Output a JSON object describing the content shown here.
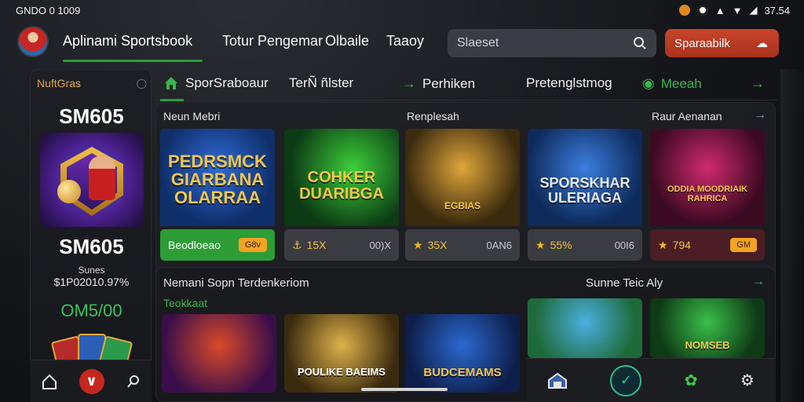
{
  "status": {
    "left_text": "GNDO 0 1009",
    "time": "37.54"
  },
  "nav": {
    "brand": "Aplinami Sportsbook",
    "items": [
      "Totur Pengemar",
      "Olbaile",
      "Taaoy"
    ]
  },
  "search": {
    "placeholder": "Slaeset"
  },
  "promo_button": "Sparaabilk",
  "sidebar": {
    "header": "NuftGras",
    "title": "SM605",
    "value_big": "SM605",
    "label_small": "Sunes",
    "amount": "$1P02010.97%",
    "green_value": "OM5/00"
  },
  "tabs": [
    {
      "label": "SporSraboaur",
      "icon": "home-icon"
    },
    {
      "label": "TerÑ ñlster",
      "icon": ""
    },
    {
      "label": "Perhiken",
      "icon": "arrow-right-icon"
    },
    {
      "label": "Pretenglstmog",
      "icon": ""
    },
    {
      "label": "Meeah",
      "icon": "target-icon"
    }
  ],
  "sections": {
    "row1_left": "Neun Mebri",
    "row1_mid": "Renplesah",
    "row1_right": "Raur Aenanan",
    "row2_left": "Nemani Sopn Terdenkeriom",
    "row2_sub": "Teokkaat",
    "row2_right": "Sunne Teic Aly"
  },
  "cards": [
    {
      "title": "PEDRSMCK GIARBANA OLARRAA",
      "rate": "",
      "pct": "",
      "badge": "Beodloeao",
      "pill": "G8v",
      "bg": "#0f3f8a",
      "text_color": "#f3c64a"
    },
    {
      "title": "COHKER DUARIBGA",
      "rate": "15X",
      "pct": "00)X",
      "badge": "",
      "pill": "",
      "bg": "#0e4a1e",
      "text_color": "#f3c64a"
    },
    {
      "title": "EGBIAS",
      "rate": "35X",
      "pct": "0AN6",
      "badge": "",
      "pill": "",
      "bg": "#1c5a35",
      "text_color": "#f3c64a"
    },
    {
      "title": "SPORSKHAR ULERIAGA",
      "rate": "55%",
      "pct": "00I6",
      "badge": "",
      "pill": "",
      "bg": "#103f7e",
      "text_color": "#e8e8e8"
    },
    {
      "title": "ODDIA MOODRIAIK RAHRICA",
      "rate": "794",
      "pct": "",
      "badge": "",
      "pill": "GM",
      "bg": "#7a1238",
      "text_color": "#f3c64a"
    }
  ],
  "cards2": [
    {
      "title": "",
      "bg": "#5a1a6e"
    },
    {
      "title": "POULIKE BAEIMS",
      "bg": "#3e2f12"
    },
    {
      "title": "BUDCEMAMS",
      "bg": "#12306a"
    },
    {
      "title": "",
      "bg": "#1e6a3a"
    },
    {
      "title": "NOMSEB",
      "bg": "#1e5a26"
    }
  ]
}
